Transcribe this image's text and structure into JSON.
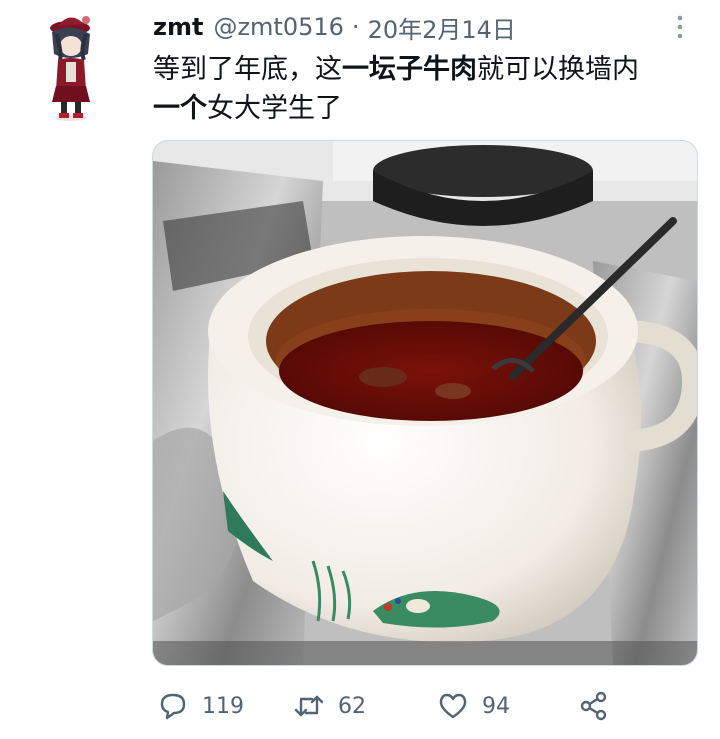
{
  "tweet": {
    "display_name": "zmt",
    "handle": "@zmt0516",
    "separator": "·",
    "date": "20年2月14日",
    "text_parts": [
      "等到了年底，这",
      "一坛子牛肉",
      "就可以换墙内",
      "一个",
      "女大学生了"
    ]
  },
  "stats": {
    "replies": "119",
    "retweets": "62",
    "likes": "94"
  },
  "icons": {
    "more": "more-vertical-icon",
    "reply": "reply-icon",
    "retweet": "retweet-icon",
    "like": "heart-icon",
    "share": "share-icon"
  },
  "colors": {
    "text_primary": "#0f1419",
    "text_secondary": "#536471",
    "border": "#cfd9de"
  }
}
